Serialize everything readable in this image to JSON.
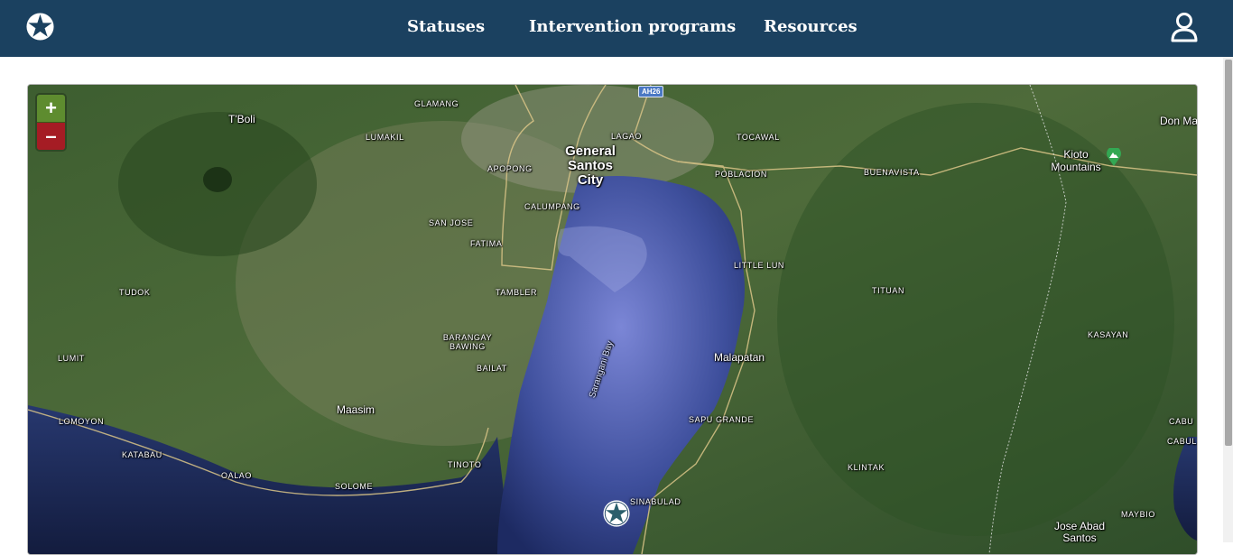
{
  "header": {
    "nav": [
      {
        "label": "Statuses"
      },
      {
        "label": "Intervention programs"
      },
      {
        "label": "Resources"
      }
    ],
    "icons": {
      "logo": "star-logo-icon",
      "user": "user-profile-icon"
    },
    "colors": {
      "bar": "#1b4160",
      "text": "#ffffff"
    }
  },
  "map": {
    "zoom": {
      "in_label": "+",
      "out_label": "–",
      "in_color": "#5e8c2f",
      "out_color": "#a51c24"
    },
    "road_shield": "AH26",
    "water_label": "Sarangani Bay",
    "marker_icon": "star-map-marker-icon",
    "peak_icon": "mountain-peak-icon",
    "places": [
      {
        "name": "GLAMANG",
        "kind": "small"
      },
      {
        "name": "T'Boli",
        "kind": "town"
      },
      {
        "name": "LUMAKIL",
        "kind": "small"
      },
      {
        "name": "LAGAO",
        "kind": "small"
      },
      {
        "name": "TOCAWAL",
        "kind": "small"
      },
      {
        "name": "Don Ma",
        "kind": "town"
      },
      {
        "name": "General Santos City",
        "kind": "city"
      },
      {
        "name": "APOPONG",
        "kind": "small"
      },
      {
        "name": "POBLACION",
        "kind": "small"
      },
      {
        "name": "BUENAVISTA",
        "kind": "small"
      },
      {
        "name": "Kioto Mountains",
        "kind": "town"
      },
      {
        "name": "CALUMPANG",
        "kind": "small"
      },
      {
        "name": "SAN JOSE",
        "kind": "small"
      },
      {
        "name": "FATIMA",
        "kind": "small"
      },
      {
        "name": "LITTLE LUN",
        "kind": "small"
      },
      {
        "name": "TUDOK",
        "kind": "small"
      },
      {
        "name": "TAMBLER",
        "kind": "small"
      },
      {
        "name": "TITUAN",
        "kind": "small"
      },
      {
        "name": "KASAYAN",
        "kind": "small"
      },
      {
        "name": "BARANGAY BAWING",
        "kind": "small"
      },
      {
        "name": "LUMIT",
        "kind": "small"
      },
      {
        "name": "Malapatan",
        "kind": "town"
      },
      {
        "name": "BAILAT",
        "kind": "small"
      },
      {
        "name": "Maasim",
        "kind": "town"
      },
      {
        "name": "LOMOYON",
        "kind": "small"
      },
      {
        "name": "SAPU GRANDE",
        "kind": "small"
      },
      {
        "name": "CABU",
        "kind": "small"
      },
      {
        "name": "CABUL",
        "kind": "small"
      },
      {
        "name": "KATABAU",
        "kind": "small"
      },
      {
        "name": "TINOTO",
        "kind": "small"
      },
      {
        "name": "KLINTAK",
        "kind": "small"
      },
      {
        "name": "OALAO",
        "kind": "small"
      },
      {
        "name": "SOLOME",
        "kind": "small"
      },
      {
        "name": "SINABULAD",
        "kind": "small"
      },
      {
        "name": "MAYBIO",
        "kind": "small"
      },
      {
        "name": "Jose Abad Santos",
        "kind": "town"
      }
    ]
  }
}
